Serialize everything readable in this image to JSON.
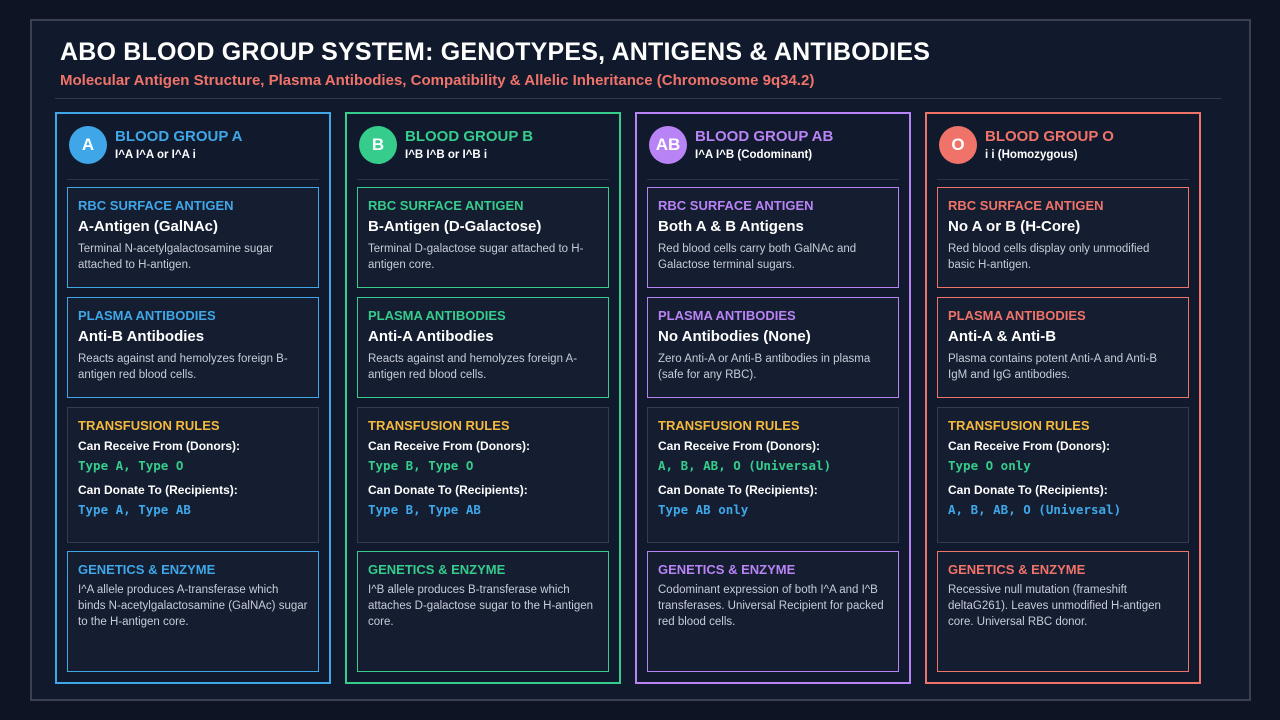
{
  "header": {
    "title": "ABO BLOOD GROUP SYSTEM: GENOTYPES, ANTIGENS & ANTIBODIES",
    "subtitle": "Molecular Antigen Structure, Plasma Antibodies, Compatibility & Allelic Inheritance (Chromosome 9q34.2)"
  },
  "colors": {
    "a": "#3fa7e8",
    "b": "#35cc8c",
    "ab": "#b884f5",
    "o": "#f0736a",
    "transfusion_label": "#f5b93c",
    "receive_value": "#35cc8c",
    "donate_value": "#3fa7e8"
  },
  "groups": [
    {
      "badge": "A",
      "title": "BLOOD GROUP A",
      "genotype": "I^A I^A or I^A i",
      "antigen": {
        "label": "RBC SURFACE ANTIGEN",
        "main": "A-Antigen (GalNAc)",
        "desc": "Terminal N-acetylgalactosamine sugar attached to H-antigen."
      },
      "antibodies": {
        "label": "PLASMA ANTIBODIES",
        "main": "Anti-B Antibodies",
        "desc": "Reacts against and hemolyzes foreign B-antigen red blood cells."
      },
      "transfusion": {
        "label": "TRANSFUSION RULES",
        "receive_label": "Can Receive From (Donors):",
        "receive": "Type A, Type O",
        "donate_label": "Can Donate To (Recipients):",
        "donate": "Type A, Type AB"
      },
      "genetics": {
        "label": "GENETICS & ENZYME",
        "desc": "I^A allele produces A-transferase which binds N-acetylgalactosamine (GalNAc) sugar to the H-antigen core."
      }
    },
    {
      "badge": "B",
      "title": "BLOOD GROUP B",
      "genotype": "I^B I^B or I^B i",
      "antigen": {
        "label": "RBC SURFACE ANTIGEN",
        "main": "B-Antigen (D-Galactose)",
        "desc": "Terminal D-galactose sugar attached to H-antigen core."
      },
      "antibodies": {
        "label": "PLASMA ANTIBODIES",
        "main": "Anti-A Antibodies",
        "desc": "Reacts against and hemolyzes foreign A-antigen red blood cells."
      },
      "transfusion": {
        "label": "TRANSFUSION RULES",
        "receive_label": "Can Receive From (Donors):",
        "receive": "Type B, Type O",
        "donate_label": "Can Donate To (Recipients):",
        "donate": "Type B, Type AB"
      },
      "genetics": {
        "label": "GENETICS & ENZYME",
        "desc": "I^B allele produces B-transferase which attaches D-galactose sugar to the H-antigen core."
      }
    },
    {
      "badge": "AB",
      "title": "BLOOD GROUP AB",
      "genotype": "I^A I^B (Codominant)",
      "antigen": {
        "label": "RBC SURFACE ANTIGEN",
        "main": "Both A & B Antigens",
        "desc": "Red blood cells carry both GalNAc and Galactose terminal sugars."
      },
      "antibodies": {
        "label": "PLASMA ANTIBODIES",
        "main": "No Antibodies (None)",
        "desc": "Zero Anti-A or Anti-B antibodies in plasma (safe for any RBC)."
      },
      "transfusion": {
        "label": "TRANSFUSION RULES",
        "receive_label": "Can Receive From (Donors):",
        "receive": "A, B, AB, O (Universal)",
        "donate_label": "Can Donate To (Recipients):",
        "donate": "Type AB only"
      },
      "genetics": {
        "label": "GENETICS & ENZYME",
        "desc": "Codominant expression of both I^A and I^B transferases. Universal Recipient for packed red blood cells."
      }
    },
    {
      "badge": "O",
      "title": "BLOOD GROUP O",
      "genotype": "i i (Homozygous)",
      "antigen": {
        "label": "RBC SURFACE ANTIGEN",
        "main": "No A or B (H-Core)",
        "desc": "Red blood cells display only unmodified basic H-antigen."
      },
      "antibodies": {
        "label": "PLASMA ANTIBODIES",
        "main": "Anti-A & Anti-B",
        "desc": "Plasma contains potent Anti-A and Anti-B IgM and IgG antibodies."
      },
      "transfusion": {
        "label": "TRANSFUSION RULES",
        "receive_label": "Can Receive From (Donors):",
        "receive": "Type O only",
        "donate_label": "Can Donate To (Recipients):",
        "donate": "A, B, AB, O (Universal)"
      },
      "genetics": {
        "label": "GENETICS & ENZYME",
        "desc": "Recessive null mutation (frameshift deltaG261). Leaves unmodified H-antigen core. Universal RBC donor."
      }
    }
  ]
}
